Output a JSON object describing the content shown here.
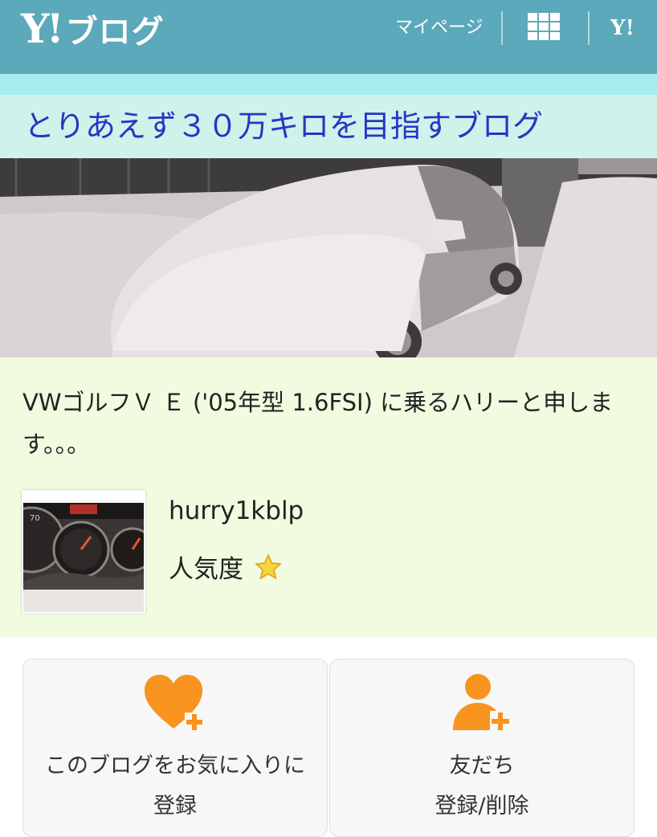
{
  "header": {
    "logo_mark": "Y!",
    "logo_text": "ブログ",
    "mypage_label": "マイページ",
    "grid_icon": "apps-grid-icon",
    "yahoo_icon_text": "Y!",
    "background": "#5ba9ba"
  },
  "blog": {
    "title": "とりあえず３０万キロを目指すブログ",
    "title_color": "#2d33c4"
  },
  "profile": {
    "description": "VWゴルフＶ Ｅ ('05年型 1.6FSI) に乗るハリーと申します。。。",
    "username": "hurry1kblp",
    "popularity_label": "人気度",
    "popularity_stars": 1
  },
  "actions": {
    "favorite_label": "このブログをお気に入りに登録",
    "friend_label": "友だち\n登録/削除",
    "accent": "#f7931e"
  }
}
